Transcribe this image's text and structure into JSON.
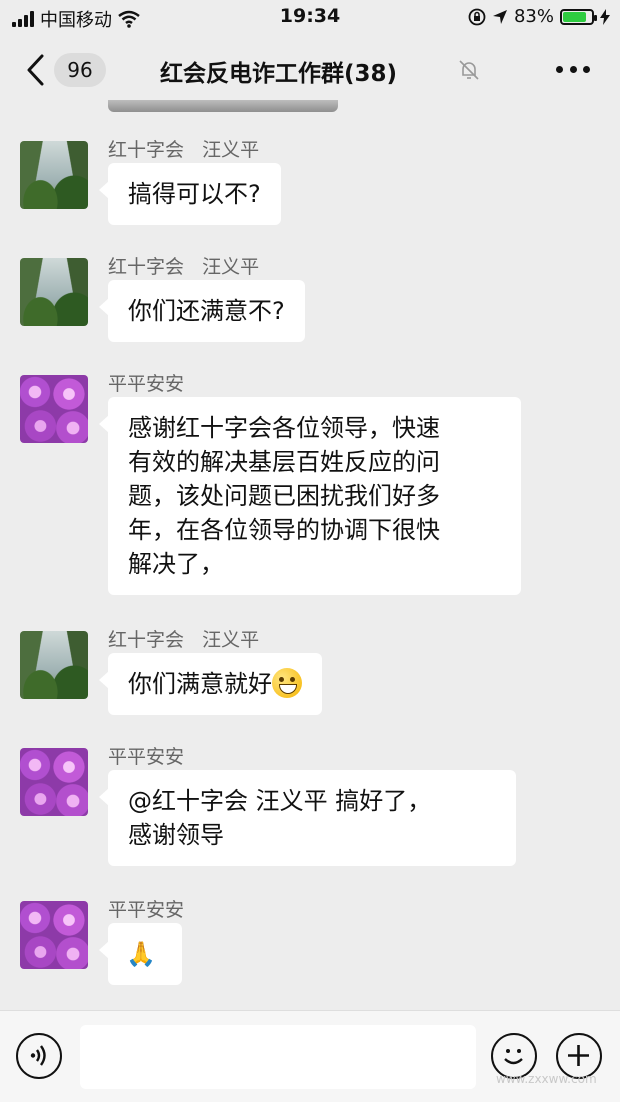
{
  "status_bar": {
    "carrier": "中国移动",
    "time": "19:34",
    "battery_percent": "83%",
    "battery_level": 0.83
  },
  "nav": {
    "unread_count": "96",
    "title": "红会反电诈工作群(38)"
  },
  "messages": [
    {
      "sender": "红十字会   汪义平",
      "avatar": "mountain",
      "text": "搞得可以不?"
    },
    {
      "sender": "红十字会   汪义平",
      "avatar": "mountain",
      "text": "你们还满意不?"
    },
    {
      "sender": "平平安安",
      "avatar": "rose",
      "lines": [
        "感谢红十字会各位领导，快速",
        "有效的解决基层百姓反应的问",
        "题，该处问题已困扰我们好多",
        "年，在各位领导的协调下很快",
        "解决了，"
      ]
    },
    {
      "sender": "红十字会   汪义平",
      "avatar": "mountain",
      "text": "你们满意就好",
      "emoji": "grinning-face-emoji"
    },
    {
      "sender": "平平安安",
      "avatar": "rose",
      "lines": [
        "@红十字会   汪义平 搞好了，",
        "感谢领导"
      ]
    },
    {
      "sender": "平平安安",
      "avatar": "rose",
      "text": "🙏"
    }
  ],
  "icons": {
    "back": "chevron-left-icon",
    "mute": "bell-muted-icon",
    "more": "more-dots-icon",
    "voice": "voice-icon",
    "emoji": "emoji-icon",
    "plus": "plus-icon"
  },
  "colors": {
    "background": "#ededed",
    "bubble": "#ffffff",
    "battery": "#2ecc40"
  },
  "watermark": "www.zxxww.com"
}
